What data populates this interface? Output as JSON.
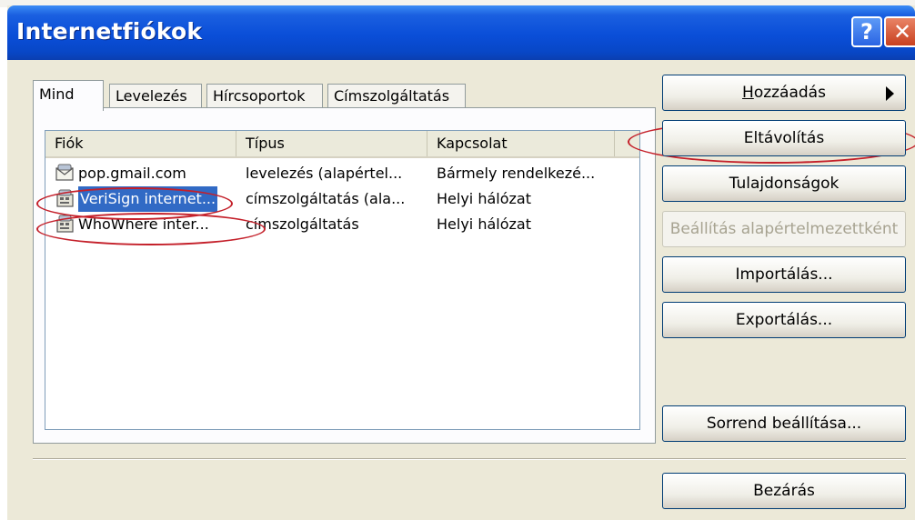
{
  "window": {
    "title": "Internetfiókok"
  },
  "titlebar": {
    "help_glyph": "?",
    "close_glyph": "✕"
  },
  "tabs": [
    {
      "label": "Mind",
      "active": true
    },
    {
      "label": "Levelezés",
      "active": false
    },
    {
      "label": "Hírcsoportok",
      "active": false
    },
    {
      "label": "Címszolgáltatás",
      "active": false
    }
  ],
  "list": {
    "columns": [
      "Fiók",
      "Típus",
      "Kapcsolat"
    ],
    "rows": [
      {
        "name": "pop.gmail.com",
        "type": "levelezés (alapértel...",
        "connection": "Bármely rendelkezé...",
        "icon": "mail-account-icon",
        "selected": false
      },
      {
        "name": "VeriSign internet...",
        "type": "címszolgáltatás (ala...",
        "connection": "Helyi hálózat",
        "icon": "directory-service-icon",
        "selected": true
      },
      {
        "name": "WhoWhere inter...",
        "type": "címszolgáltatás",
        "connection": "Helyi hálózat",
        "icon": "directory-service-icon",
        "selected": false
      }
    ]
  },
  "buttons": {
    "add": {
      "prefix": "",
      "mnemonic": "H",
      "rest": "ozzáadás"
    },
    "remove": "Eltávolítás",
    "properties": "Tulajdonságok",
    "set_default": "Beállítás alapértelmezettként",
    "import": "Importálás...",
    "export": "Exportálás...",
    "order": "Sorrend beállítása...",
    "close": "Bezárás"
  },
  "colors": {
    "titlebar": "#0a4ed8",
    "selection": "#316ac5",
    "annotation": "#c4202a"
  }
}
